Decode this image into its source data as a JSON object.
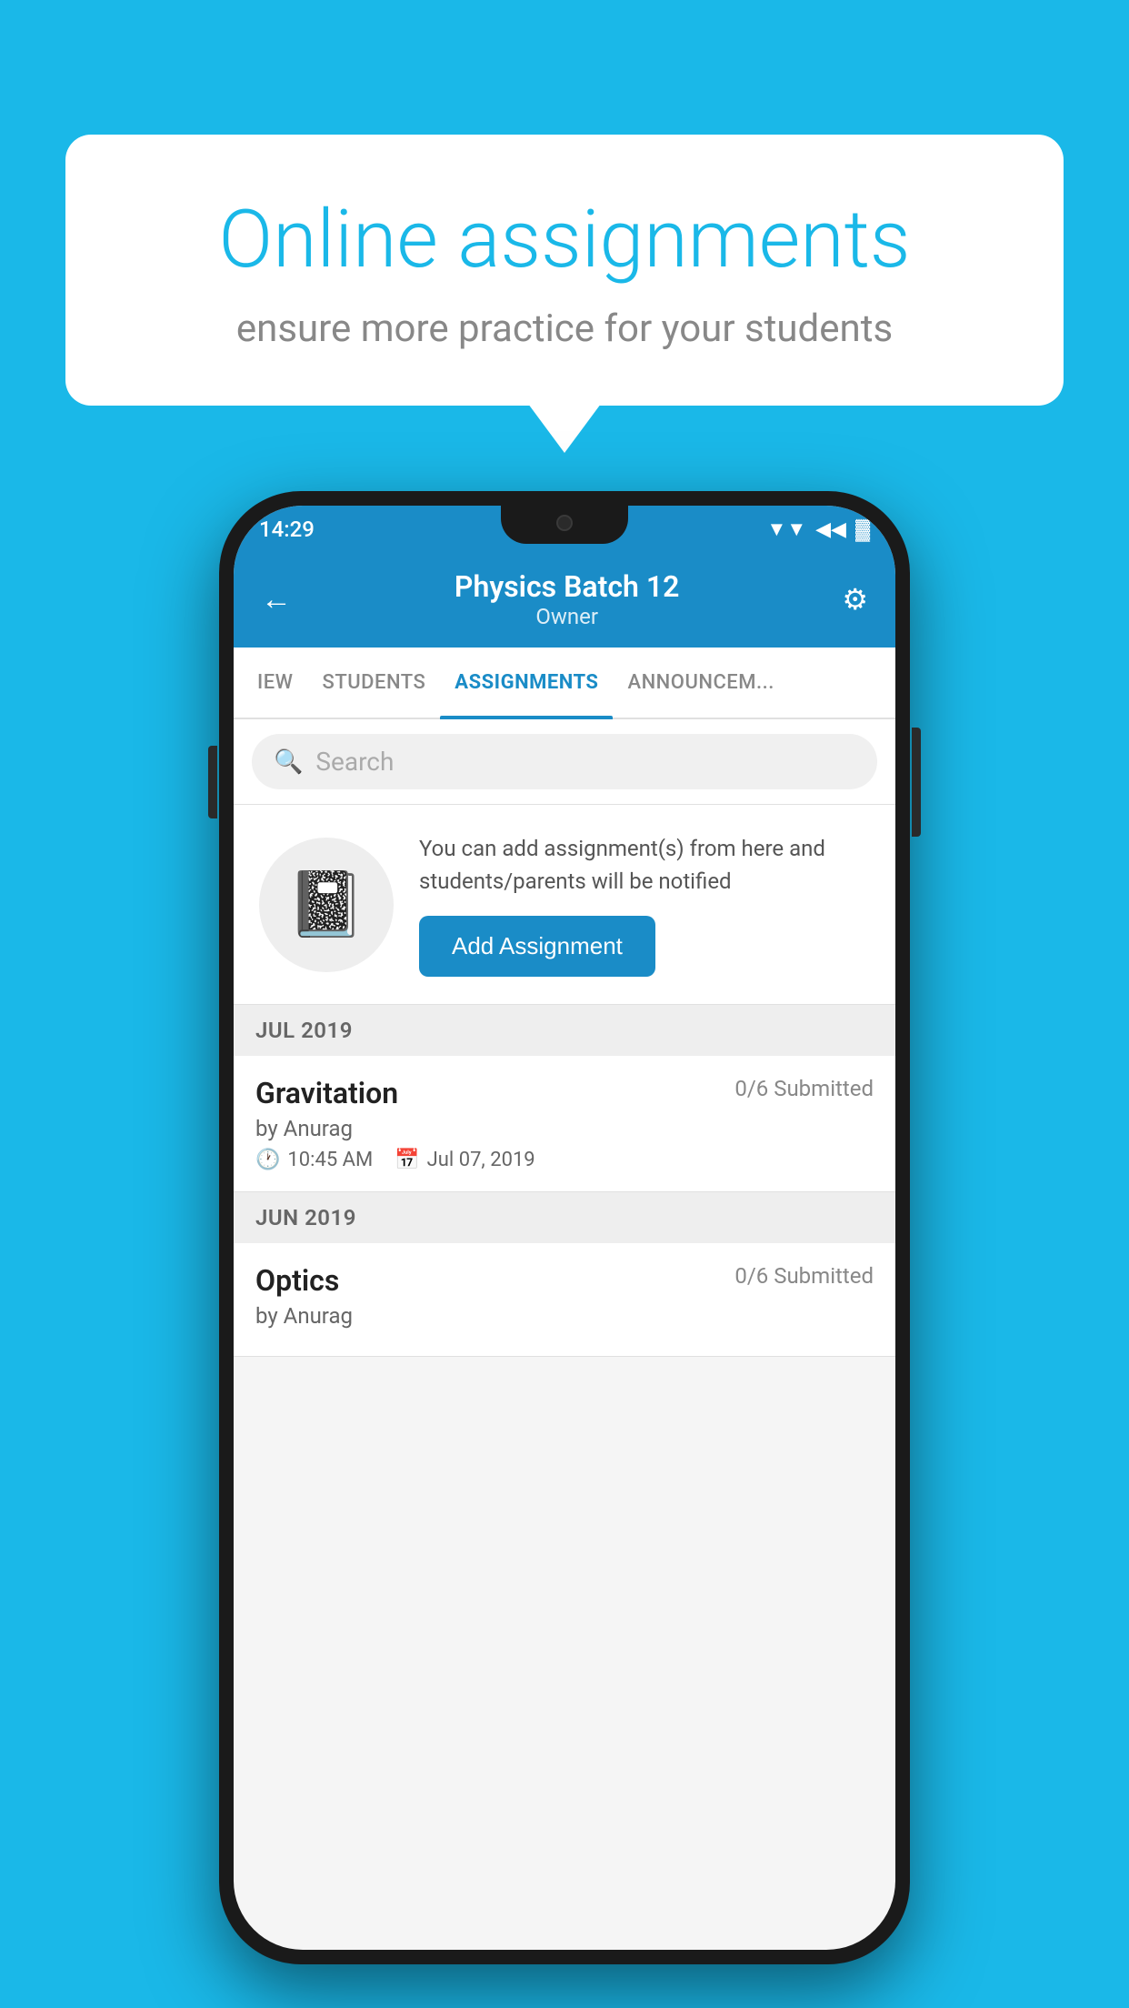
{
  "background": {
    "color": "#1ab8e8"
  },
  "speech_bubble": {
    "title": "Online assignments",
    "subtitle": "ensure more practice for your students"
  },
  "status_bar": {
    "time": "14:29",
    "wifi": "▲",
    "signal": "▲",
    "battery": "▌"
  },
  "app_header": {
    "title": "Physics Batch 12",
    "subtitle": "Owner",
    "back_label": "←",
    "settings_label": "⚙"
  },
  "tabs": [
    {
      "label": "IEW",
      "active": false
    },
    {
      "label": "STUDENTS",
      "active": false
    },
    {
      "label": "ASSIGNMENTS",
      "active": true
    },
    {
      "label": "ANNOUNCEM...",
      "active": false
    }
  ],
  "search": {
    "placeholder": "Search"
  },
  "promo_card": {
    "description": "You can add assignment(s) from here and students/parents will be notified",
    "button_label": "Add Assignment",
    "icon": "📓"
  },
  "sections": [
    {
      "header": "JUL 2019",
      "items": [
        {
          "name": "Gravitation",
          "submitted": "0/6 Submitted",
          "author": "by Anurag",
          "time": "10:45 AM",
          "date": "Jul 07, 2019"
        }
      ]
    },
    {
      "header": "JUN 2019",
      "items": [
        {
          "name": "Optics",
          "submitted": "0/6 Submitted",
          "author": "by Anurag",
          "time": "",
          "date": ""
        }
      ]
    }
  ]
}
